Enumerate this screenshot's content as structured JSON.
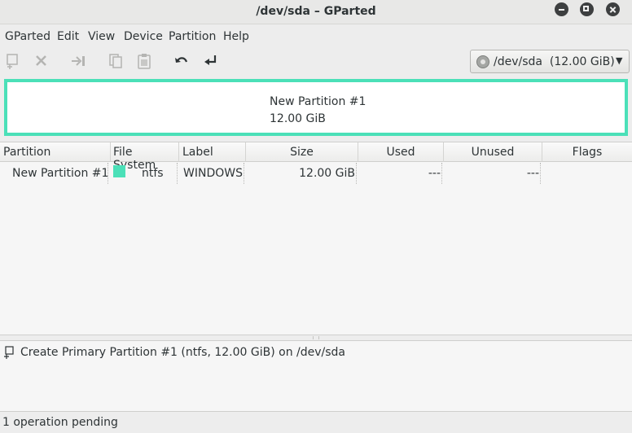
{
  "window": {
    "title": "/dev/sda – GParted"
  },
  "menu": [
    "GParted",
    "Edit",
    "View",
    "Device",
    "Partition",
    "Help"
  ],
  "toolbar": {
    "buttons": [
      "new-partition-icon",
      "delete-icon",
      "resize-move-icon",
      "copy-icon",
      "paste-icon",
      "undo-icon",
      "apply-icon"
    ]
  },
  "device": {
    "label": "/dev/sda  (12.00 GiB)"
  },
  "partition_map": {
    "name": "New Partition #1",
    "size": "12.00 GiB",
    "color": "#4be0b8"
  },
  "table": {
    "headers": [
      "Partition",
      "File System",
      "Label",
      "Size",
      "Used",
      "Unused",
      "Flags"
    ],
    "rows": [
      {
        "partition": "New Partition #1",
        "filesystem": "ntfs",
        "fs_color": "#4be0b8",
        "label": "WINDOWS",
        "size": "12.00 GiB",
        "used": "---",
        "unused": "---",
        "flags": ""
      }
    ]
  },
  "operations": [
    "Create Primary Partition #1 (ntfs, 12.00 GiB) on /dev/sda"
  ],
  "status": "1 operation pending"
}
